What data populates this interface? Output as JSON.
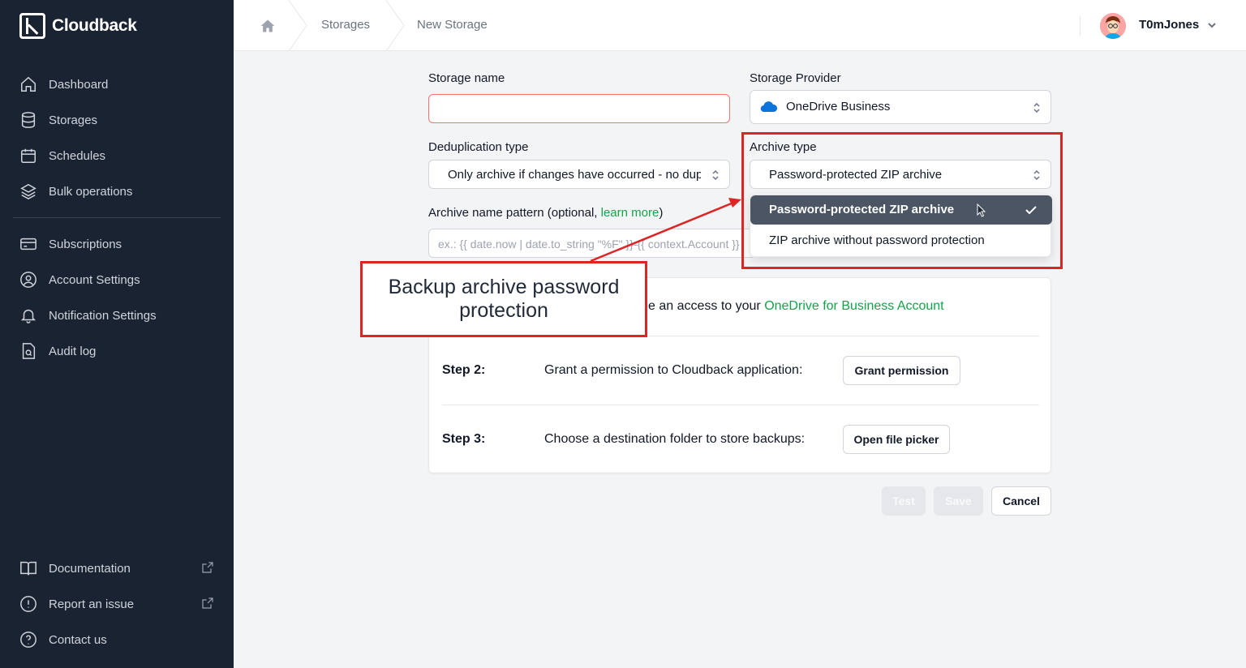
{
  "app": {
    "name": "Cloudback"
  },
  "sidebar": {
    "items": [
      {
        "label": "Dashboard",
        "icon": "home-icon"
      },
      {
        "label": "Storages",
        "icon": "database-icon"
      },
      {
        "label": "Schedules",
        "icon": "calendar-icon"
      },
      {
        "label": "Bulk operations",
        "icon": "layers-icon"
      },
      {
        "label": "Subscriptions",
        "icon": "credit-card-icon"
      },
      {
        "label": "Account Settings",
        "icon": "user-circle-icon"
      },
      {
        "label": "Notification Settings",
        "icon": "bell-icon"
      },
      {
        "label": "Audit log",
        "icon": "file-search-icon"
      }
    ],
    "bottom_items": [
      {
        "label": "Documentation",
        "icon": "book-icon",
        "external": true
      },
      {
        "label": "Report an issue",
        "icon": "alert-circle-icon",
        "external": true
      },
      {
        "label": "Contact us",
        "icon": "help-circle-icon",
        "external": false
      }
    ]
  },
  "header": {
    "breadcrumbs": [
      "Storages",
      "New Storage"
    ],
    "user": {
      "name": "T0mJones"
    }
  },
  "form": {
    "storage_name": {
      "label": "Storage name",
      "value": ""
    },
    "storage_provider": {
      "label": "Storage Provider",
      "value": "OneDrive Business"
    },
    "dedup": {
      "label": "Deduplication type",
      "value": "Only archive if changes have occurred - no duplicates"
    },
    "archive_type": {
      "label": "Archive type",
      "value": "Password-protected ZIP archive",
      "options": [
        "Password-protected ZIP archive",
        "ZIP archive without password protection"
      ]
    },
    "archive_pattern": {
      "label_prefix": "Archive name pattern (optional, ",
      "link": "learn more",
      "label_suffix": ")",
      "placeholder": "ex.: {{ date.now | date.to_string \"%F\" }}-{{ context.Account }}"
    }
  },
  "steps": {
    "step1": {
      "text": "e an access to your ",
      "link": "OneDrive for Business Account"
    },
    "step2": {
      "label": "Step 2:",
      "text": "Grant a permission to Cloudback application:",
      "button": "Grant permission"
    },
    "step3": {
      "label": "Step 3:",
      "text": "Choose a destination folder to store backups:",
      "button": "Open file picker"
    }
  },
  "actions": {
    "test": "Test",
    "save": "Save",
    "cancel": "Cancel"
  },
  "annotation": {
    "callout": "Backup archive password protection"
  },
  "colors": {
    "sidebar": "#1a2332",
    "accent": "#16a34a",
    "annotation": "#dc2626",
    "selected_option": "#4b5563"
  }
}
